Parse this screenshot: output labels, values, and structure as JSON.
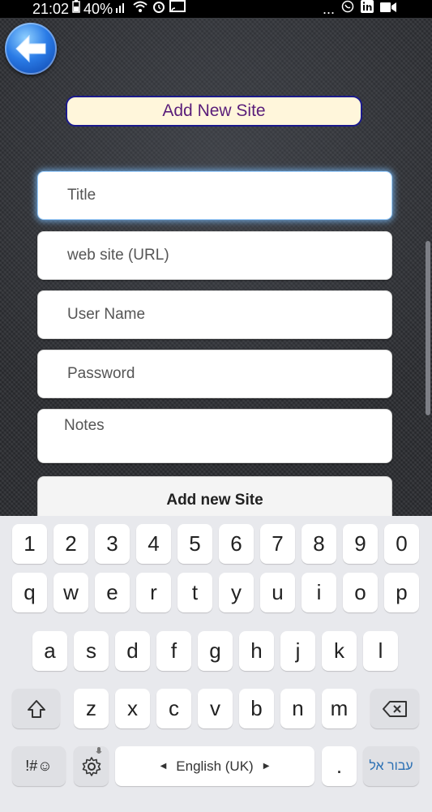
{
  "status_bar": {
    "time": "21:02",
    "battery": "40%",
    "more": "..."
  },
  "app": {
    "header_title": "Add New Site",
    "fields": {
      "title_placeholder": "Title",
      "url_placeholder": "web site (URL)",
      "username_placeholder": "User Name",
      "password_placeholder": "Password",
      "notes_placeholder": "Notes"
    },
    "submit_label": "Add new Site"
  },
  "keyboard": {
    "row_numbers": [
      "1",
      "2",
      "3",
      "4",
      "5",
      "6",
      "7",
      "8",
      "9",
      "0"
    ],
    "row1": [
      "q",
      "w",
      "e",
      "r",
      "t",
      "y",
      "u",
      "i",
      "o",
      "p"
    ],
    "row2": [
      "a",
      "s",
      "d",
      "f",
      "g",
      "h",
      "j",
      "k",
      "l"
    ],
    "row3": [
      "z",
      "x",
      "c",
      "v",
      "b",
      "n",
      "m"
    ],
    "symbols_label": "!#☺",
    "language_label": "English (UK)",
    "period_label": ".",
    "hebrew_label": "עבור אל"
  },
  "colors": {
    "accent_blue": "#2a7be6",
    "header_bg": "#fff6db",
    "header_border": "#1b1a8c",
    "header_text": "#5a1e7a"
  }
}
